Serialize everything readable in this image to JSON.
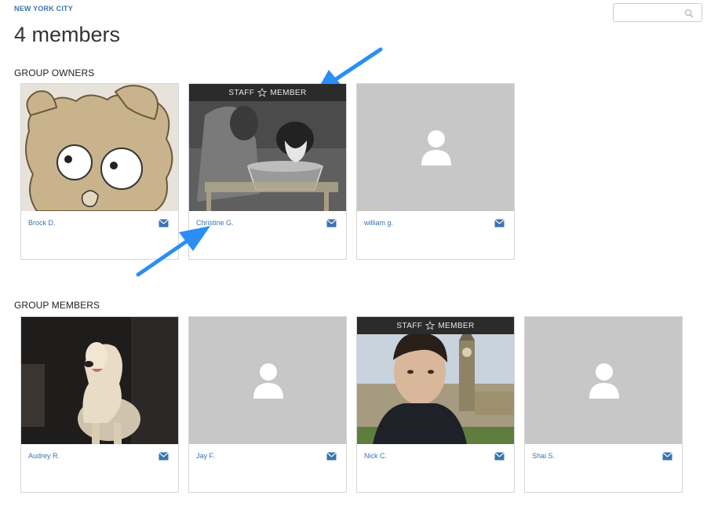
{
  "breadcrumb": "NEW YORK CITY",
  "page_title": "4 members",
  "search": {
    "placeholder": ""
  },
  "sections": {
    "owners_title": "GROUP OWNERS",
    "members_title": "GROUP MEMBERS"
  },
  "staff_label": {
    "left": "STAFF",
    "right": "MEMBER"
  },
  "owners": [
    {
      "name": "Brock D.",
      "photo": "drawing-photo",
      "staff": false
    },
    {
      "name": "Christine G.",
      "photo": "vintage-photo",
      "staff": true
    },
    {
      "name": "william g.",
      "photo": "placeholder",
      "staff": false
    }
  ],
  "members": [
    {
      "name": "Audrey R.",
      "photo": "dog-photo",
      "staff": false
    },
    {
      "name": "Jay F.",
      "photo": "placeholder",
      "staff": false
    },
    {
      "name": "Nick C.",
      "photo": "selfie-photo",
      "staff": true
    },
    {
      "name": "Shai S.",
      "photo": "placeholder",
      "staff": false
    }
  ],
  "colors": {
    "link": "#3b73af",
    "placeholder_bg": "#c7c7c7",
    "staff_bar": "#2b2b2b",
    "annotation_arrow": "#2a8ef5"
  },
  "icons": [
    "search-icon",
    "mail-icon",
    "star-icon",
    "person-placeholder-icon",
    "annotation-arrow"
  ]
}
